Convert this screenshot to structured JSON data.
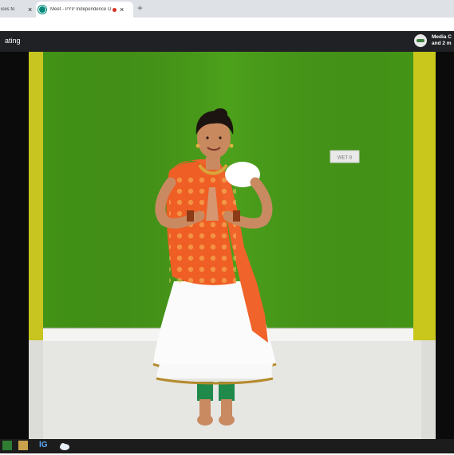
{
  "browser": {
    "tabs": [
      {
        "label": "ices fo"
      },
      {
        "label": "Meet - PYP Independence D"
      }
    ],
    "new_tab_symbol": "+",
    "close_symbol": "×"
  },
  "meet": {
    "title_fragment": "ating",
    "presenter_line1": "Media C",
    "presenter_line2": "and 2 m"
  },
  "video": {
    "wall_sign": "WET 8",
    "colors": {
      "wall_green": "#4aa01a",
      "side_wall_yellow": "#c9c61c",
      "floor": "#e8e8e6",
      "dupatta_orange": "#f0632a",
      "dress_white": "#fafafa",
      "legging_green": "#1f8a4a"
    }
  },
  "taskbar": {
    "icons": [
      "app-green-icon",
      "folder-icon",
      "lg-icon",
      "cloud-icon"
    ],
    "lg_text": "lG"
  }
}
